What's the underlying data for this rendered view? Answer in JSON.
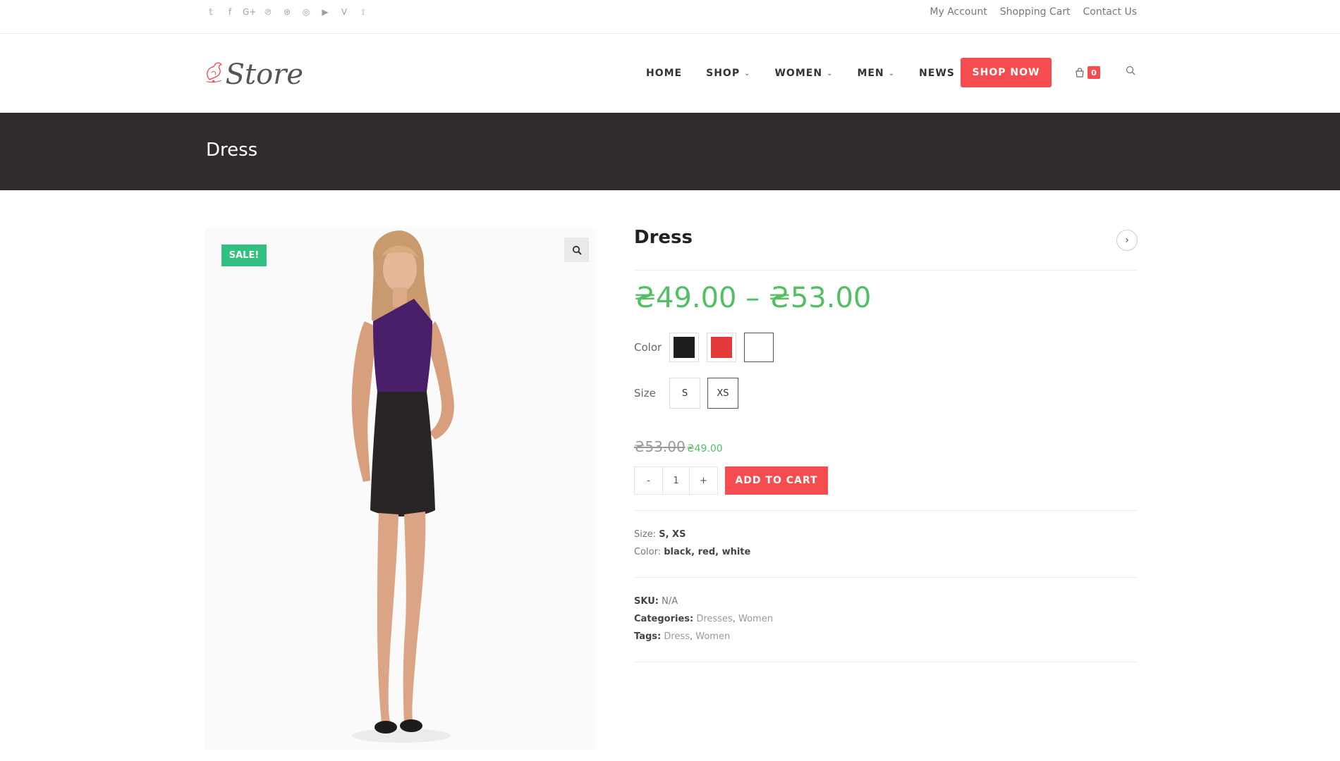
{
  "topbar": {
    "social_icons": [
      "twitter-icon",
      "facebook-icon",
      "google-plus-icon",
      "pinterest-icon",
      "dribbble-icon",
      "instagram-icon",
      "youtube-icon",
      "vine-icon",
      "rss-icon"
    ],
    "social_glyphs": [
      "𝕥",
      "f",
      "G+",
      "℗",
      "⊛",
      "◎",
      "▶",
      "V",
      "⟟"
    ],
    "links": [
      "My Account",
      "Shopping Cart",
      "Contact Us"
    ]
  },
  "header": {
    "logo_text": "Store",
    "nav": [
      {
        "label": "HOME",
        "dropdown": false
      },
      {
        "label": "SHOP",
        "dropdown": true
      },
      {
        "label": "WOMEN",
        "dropdown": true
      },
      {
        "label": "MEN",
        "dropdown": true
      },
      {
        "label": "NEWS",
        "dropdown": false
      }
    ],
    "cta": "SHOP NOW",
    "cart_count": "0"
  },
  "page_title": "Dress",
  "product": {
    "sale_badge": "SALE!",
    "title": "Dress",
    "price_range": "₴49.00 – ₴53.00",
    "color_label": "Color",
    "colors": [
      {
        "name": "black",
        "hex": "#1e1e1e",
        "selected": false
      },
      {
        "name": "red",
        "hex": "#e23a3a",
        "selected": false
      },
      {
        "name": "white",
        "hex": "#ffffff",
        "selected": true
      }
    ],
    "size_label": "Size",
    "sizes": [
      {
        "label": "S",
        "selected": false
      },
      {
        "label": "XS",
        "selected": true
      }
    ],
    "old_price": "₴53.00",
    "new_price": "₴49.00",
    "qty_minus": "-",
    "qty_value": "1",
    "qty_plus": "+",
    "add_to_cart": "ADD TO CART",
    "attributes": {
      "size_label": "Size:",
      "size_value": "S, XS",
      "color_label": "Color:",
      "color_value": "black, red, white"
    },
    "meta": {
      "sku_label": "SKU:",
      "sku_value": "N/A",
      "categories_label": "Categories:",
      "category_1": "Dresses",
      "category_2": "Women",
      "tags_label": "Tags:",
      "tag_1": "Dress",
      "tag_2": "Women"
    }
  },
  "colors": {
    "accent_red": "#f54d4f",
    "sale_green": "#32c07e",
    "price_green": "#52c062",
    "title_band": "#312b2b"
  }
}
